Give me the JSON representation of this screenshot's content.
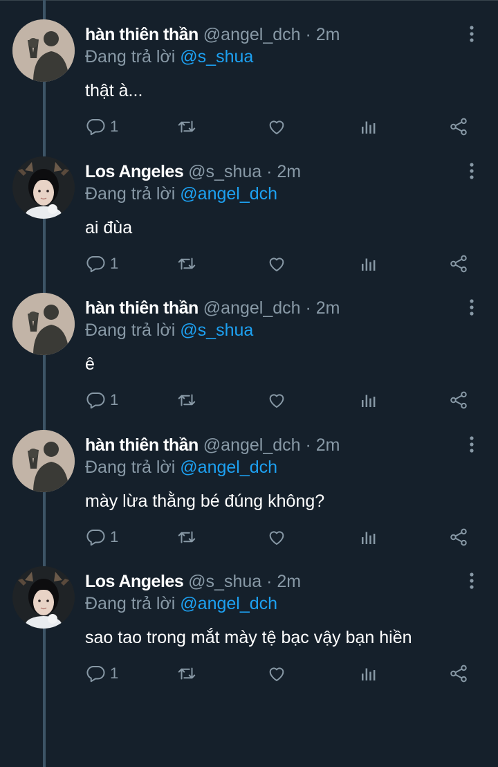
{
  "tweets": [
    {
      "name": "hàn thiên thần",
      "handle": "@angel_dch",
      "dot": "·",
      "time": "2m",
      "reply_prefix": "Đang trả lời",
      "reply_to": "@s_shua",
      "text": "thật à...",
      "reply_count": "1",
      "avatar": "shadow-avatar"
    },
    {
      "name": "Los Angeles",
      "handle": "@s_shua",
      "dot": "·",
      "time": "2m",
      "reply_prefix": "Đang trả lời",
      "reply_to": "@angel_dch",
      "text": "ai đùa",
      "reply_count": "1",
      "avatar": "person-avatar"
    },
    {
      "name": "hàn thiên thần",
      "handle": "@angel_dch",
      "dot": "·",
      "time": "2m",
      "reply_prefix": "Đang trả lời",
      "reply_to": "@s_shua",
      "text": "ê",
      "reply_count": "1",
      "avatar": "shadow-avatar"
    },
    {
      "name": "hàn thiên thần",
      "handle": "@angel_dch",
      "dot": "·",
      "time": "2m",
      "reply_prefix": "Đang trả lời",
      "reply_to": "@angel_dch",
      "text": "mày lừa thằng bé đúng không?",
      "reply_count": "1",
      "avatar": "shadow-avatar"
    },
    {
      "name": "Los Angeles",
      "handle": "@s_shua",
      "dot": "·",
      "time": "2m",
      "reply_prefix": "Đang trả lời",
      "reply_to": "@angel_dch",
      "text": "sao tao trong mắt mày tệ bạc vậy bạn hiền",
      "reply_count": "1",
      "avatar": "person-avatar"
    }
  ],
  "colors": {
    "background": "#15202b",
    "secondary_text": "#8899a6",
    "mention": "#1da1f2",
    "thread_line": "#3d5466"
  }
}
